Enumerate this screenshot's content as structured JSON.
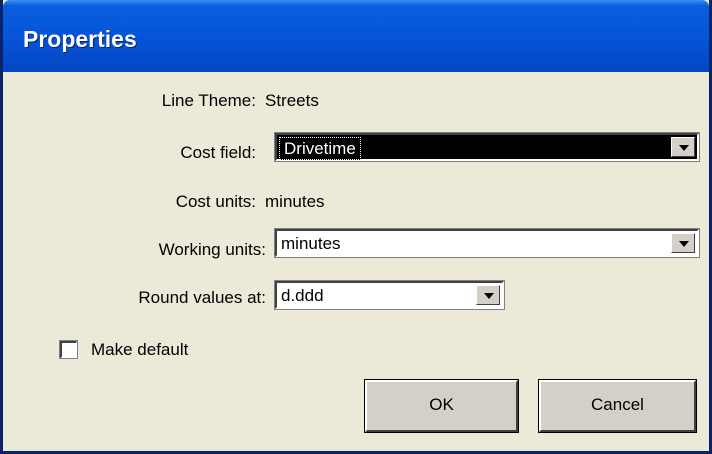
{
  "window": {
    "title": "Properties"
  },
  "form": {
    "line_theme_label": "Line Theme:",
    "line_theme_value": "Streets",
    "cost_field_label": "Cost field:",
    "cost_field_value": "Drivetime",
    "cost_units_label": "Cost units:",
    "cost_units_value": "minutes",
    "working_units_label": "Working units:",
    "working_units_value": "minutes",
    "round_values_label": "Round values at:",
    "round_values_value": "d.ddd",
    "make_default_label": "Make default",
    "make_default_checked": false
  },
  "buttons": {
    "ok": "OK",
    "cancel": "Cancel"
  },
  "icons": {
    "dropdown_arrow": "chevron-down-icon",
    "checkbox": "checkbox-icon"
  },
  "colors": {
    "titlebar": "#0653d8",
    "face": "#ece9d8",
    "selection": "#000000"
  }
}
